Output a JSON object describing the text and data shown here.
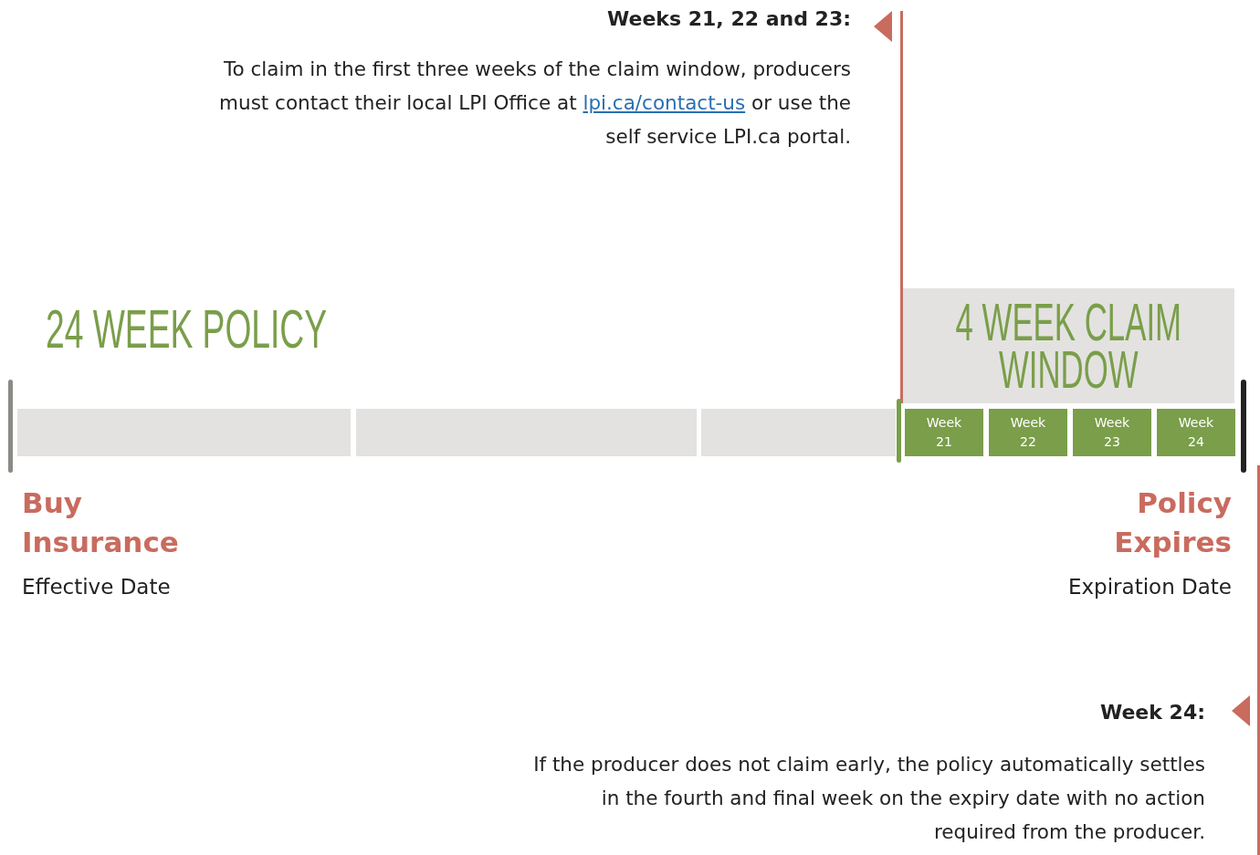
{
  "callouts": [
    {
      "heading": "Weeks 21, 22 and 23:",
      "text_before": "To claim in the first three weeks of the claim window, producers must contact their local LPI Office at",
      "link": "lpi.ca/contact-us",
      "text_after": " or use the self service LPI.ca portal."
    },
    {
      "heading": "Week 24:",
      "text_before": "If the producer does not claim early, the policy automatically settles in the fourth and final week on the expiry date with no action required from the producer."
    }
  ],
  "policy": {
    "title": "24 WEEK POLICY"
  },
  "claim_window": {
    "title": "4 WEEK CLAIM\nWINDOW",
    "weeks": [
      "Week\n21",
      "Week\n22",
      "Week\n23",
      "Week\n24"
    ]
  },
  "start": {
    "title": "Buy\nInsurance",
    "subtitle": "Effective Date"
  },
  "end": {
    "title": "Policy\nExpires",
    "subtitle": "Expiration Date"
  }
}
